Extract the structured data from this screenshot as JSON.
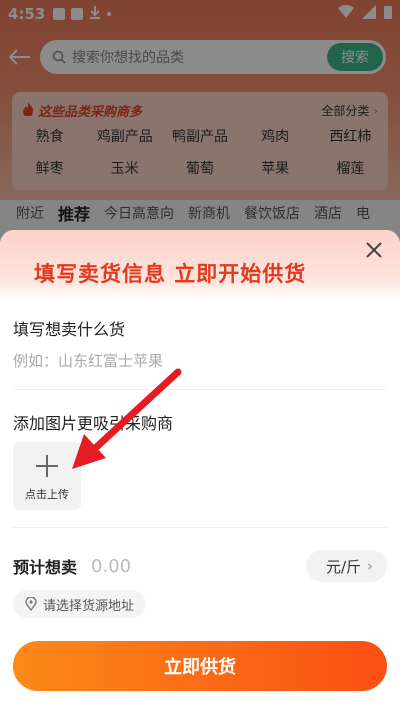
{
  "status_bar": {
    "time": "4:53"
  },
  "search": {
    "placeholder": "搜索你想找的品类",
    "button": "搜索"
  },
  "categories": {
    "title": "这些品类采购商多",
    "all_label": "全部分类",
    "items": [
      "熟食",
      "鸡副产品",
      "鸭副产品",
      "鸡肉",
      "西红柿",
      "鲜枣",
      "玉米",
      "葡萄",
      "苹果",
      "榴莲"
    ]
  },
  "tabs": [
    "附近",
    "推荐",
    "今日高意向",
    "新商机",
    "餐饮饭店",
    "酒店",
    "电"
  ],
  "active_tab": "推荐",
  "sheet": {
    "title": "填写卖货信息 立即开始供货",
    "sell_title": "填写想卖什么货",
    "sell_placeholder": "例如：山东红富士苹果",
    "image_title": "添加图片更吸引采购商",
    "upload_label": "点击上传",
    "price_label": "预计想卖",
    "price_value": "0.00",
    "unit": "元/斤",
    "address_placeholder": "请选择货源地址",
    "submit": "立即供货"
  },
  "colors": {
    "accent": "#e23a1e",
    "button_start": "#fb8a18",
    "button_end": "#fb4f14",
    "search_btn": "#3eb48a"
  }
}
